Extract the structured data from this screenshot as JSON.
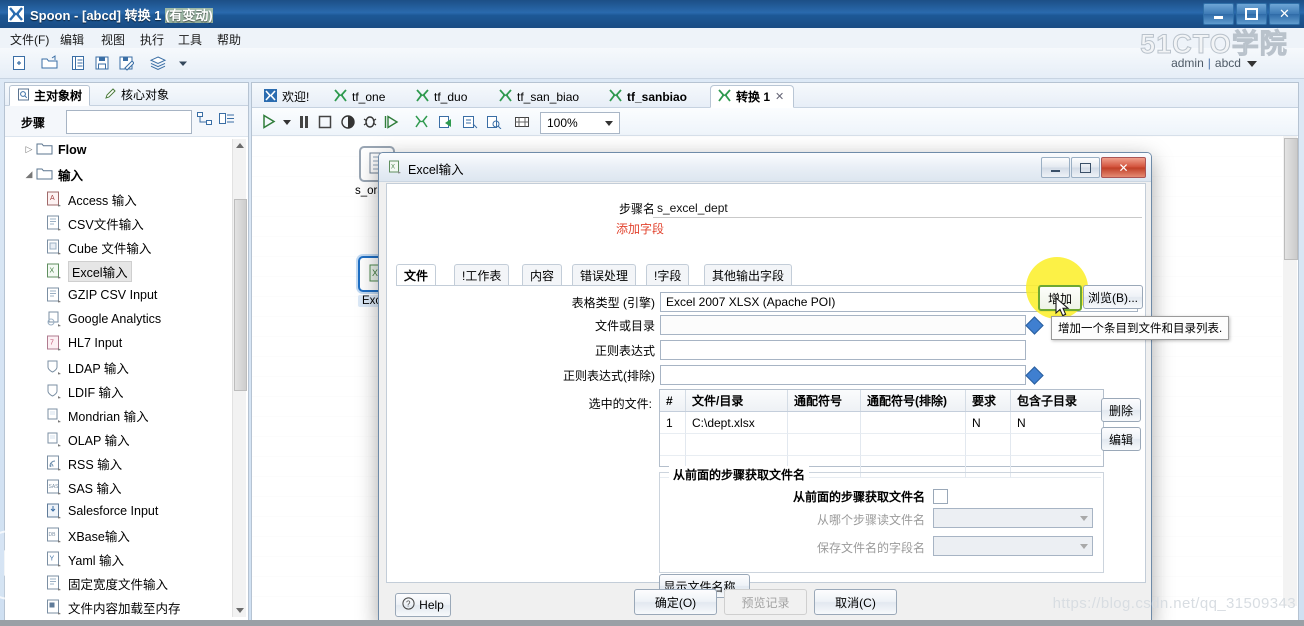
{
  "window": {
    "title_main": "Spoon - [abcd] 转换 1 ",
    "title_highlight": "(有变动)",
    "app_icon": "spoon-icon",
    "buttons": {
      "minimize": "–",
      "maximize": "□",
      "close": "✕"
    }
  },
  "menubar": {
    "items": [
      "文件(F)",
      "编辑",
      "视图",
      "执行",
      "工具",
      "帮助"
    ]
  },
  "toolbar": {
    "icons": [
      "new-file-icon",
      "open-folder-icon",
      "list-icon",
      "save-icon",
      "save-as-icon",
      "layers-icon",
      "dropdown-caret-icon"
    ]
  },
  "watermark": {
    "logo": "51CTO学院",
    "user": "admin",
    "separator": "|",
    "workspace": "abcd",
    "url": "https://blog.csdn.net/qq_31509343"
  },
  "left_panel": {
    "tabs": [
      {
        "label": "主对象树",
        "icon": "document-search-icon",
        "active": true
      },
      {
        "label": "核心对象",
        "icon": "pencil-icon",
        "active": false
      }
    ],
    "search": {
      "label": "步骤",
      "value": "",
      "placeholder": ""
    },
    "search_icons": [
      "expand-all-icon",
      "collapse-all-icon"
    ],
    "tree": [
      {
        "label": "Flow",
        "type": "folder",
        "expanded": false,
        "indent": 0
      },
      {
        "label": "输入",
        "type": "folder",
        "expanded": true,
        "indent": 0
      },
      {
        "label": "Access 输入",
        "type": "step",
        "icon": "access-input-icon",
        "indent": 1
      },
      {
        "label": "CSV文件输入",
        "type": "step",
        "icon": "csv-input-icon",
        "indent": 1
      },
      {
        "label": "Cube 文件输入",
        "type": "step",
        "icon": "cube-input-icon",
        "indent": 1
      },
      {
        "label": "Excel输入",
        "type": "step",
        "icon": "excel-input-icon",
        "indent": 1,
        "selected": true
      },
      {
        "label": "GZIP CSV Input",
        "type": "step",
        "icon": "gzip-csv-icon",
        "indent": 1
      },
      {
        "label": "Google Analytics",
        "type": "step",
        "icon": "google-analytics-icon",
        "indent": 1
      },
      {
        "label": "HL7 Input",
        "type": "step",
        "icon": "hl7-input-icon",
        "indent": 1
      },
      {
        "label": "LDAP 输入",
        "type": "step",
        "icon": "ldap-input-icon",
        "indent": 1
      },
      {
        "label": "LDIF 输入",
        "type": "step",
        "icon": "ldif-input-icon",
        "indent": 1
      },
      {
        "label": "Mondrian 输入",
        "type": "step",
        "icon": "mondrian-input-icon",
        "indent": 1
      },
      {
        "label": "OLAP 输入",
        "type": "step",
        "icon": "olap-input-icon",
        "indent": 1
      },
      {
        "label": "RSS 输入",
        "type": "step",
        "icon": "rss-input-icon",
        "indent": 1
      },
      {
        "label": "SAS 输入",
        "type": "step",
        "icon": "sas-input-icon",
        "indent": 1
      },
      {
        "label": "Salesforce Input",
        "type": "step",
        "icon": "salesforce-input-icon",
        "indent": 1
      },
      {
        "label": "XBase输入",
        "type": "step",
        "icon": "xbase-input-icon",
        "indent": 1
      },
      {
        "label": "Yaml 输入",
        "type": "step",
        "icon": "yaml-input-icon",
        "indent": 1
      },
      {
        "label": "固定宽度文件输入",
        "type": "step",
        "icon": "fixed-width-input-icon",
        "indent": 1
      },
      {
        "label": "文件内容加载至内存",
        "type": "step",
        "icon": "load-file-content-icon",
        "indent": 1
      }
    ]
  },
  "editor": {
    "tabs": [
      {
        "label": "欢迎!",
        "icon": "welcome-icon",
        "active": false,
        "bold": false,
        "closable": false
      },
      {
        "label": "tf_one",
        "icon": "transform-icon",
        "active": false,
        "bold": false,
        "closable": false
      },
      {
        "label": "tf_duo",
        "icon": "transform-icon",
        "active": false,
        "bold": false,
        "closable": false
      },
      {
        "label": "tf_san_biao",
        "icon": "transform-icon",
        "active": false,
        "bold": false,
        "closable": false
      },
      {
        "label": "tf_sanbiao",
        "icon": "transform-icon",
        "active": false,
        "bold": true,
        "closable": false
      },
      {
        "label": "转换 1",
        "icon": "transform-icon",
        "active": true,
        "bold": true,
        "closable": true
      }
    ],
    "toolbar_icons": [
      "run-icon",
      "run-dropdown-icon",
      "pause-icon",
      "stop-icon",
      "preview-icon",
      "debug-icon",
      "replay-icon",
      "transform-settings-icon",
      "export-icon",
      "db-icon",
      "inspect-icon",
      "grid-icon"
    ],
    "zoom": "100%",
    "canvas_steps": [
      {
        "label": "s_oracle",
        "icon": "table-input-icon",
        "selected": false
      },
      {
        "label": "Excel",
        "icon": "excel-input-icon",
        "selected": true
      }
    ]
  },
  "dialog": {
    "title": "Excel输入",
    "title_icon": "excel-dialog-icon",
    "window_buttons": {
      "minimize": "–",
      "maximize": "□",
      "close": "✕"
    },
    "step_name": {
      "label": "步骤名称",
      "value": "s_excel_dept"
    },
    "add_fields_link": "添加字段",
    "tabs": [
      {
        "label": "文件",
        "active": true
      },
      {
        "label": "!工作表",
        "active": false
      },
      {
        "label": "内容",
        "active": false
      },
      {
        "label": "错误处理",
        "active": false
      },
      {
        "label": "!字段",
        "active": false
      },
      {
        "label": "其他输出字段",
        "active": false
      }
    ],
    "fields": {
      "engine": {
        "label": "表格类型 (引擎)",
        "value": "Excel 2007 XLSX (Apache POI)"
      },
      "file_or_dir": {
        "label": "文件或目录",
        "value": ""
      },
      "regexp": {
        "label": "正则表达式",
        "value": ""
      },
      "regexp_exclude": {
        "label": "正则表达式(排除)",
        "value": ""
      }
    },
    "buttons": {
      "add": "增加",
      "browse": "浏览(B)...",
      "delete": "删除",
      "edit": "编辑",
      "show_filenames": "显示文件名称...",
      "help": "Help",
      "ok": "确定(O)",
      "preview": "预览记录",
      "cancel": "取消(C)"
    },
    "tooltip": "增加一个条目到文件和目录列表.",
    "selected_files": {
      "label": "选中的文件:",
      "columns": [
        "#",
        "文件/目录",
        "通配符号",
        "通配符号(排除)",
        "要求",
        "包含子目录"
      ],
      "rows": [
        [
          "1",
          "C:\\dept.xlsx",
          "",
          "",
          "N",
          "N"
        ],
        [
          "",
          "",
          "",
          "",
          "",
          ""
        ],
        [
          "",
          "",
          "",
          "",
          "",
          ""
        ]
      ]
    },
    "prev_step_group": {
      "title": "从前面的步骤获取文件名",
      "checkbox_label": "从前面的步骤获取文件名",
      "checked": false,
      "step_field": {
        "label": "从哪个步骤读文件名",
        "value": ""
      },
      "filename_field": {
        "label": "保存文件名的字段名",
        "value": ""
      }
    }
  }
}
